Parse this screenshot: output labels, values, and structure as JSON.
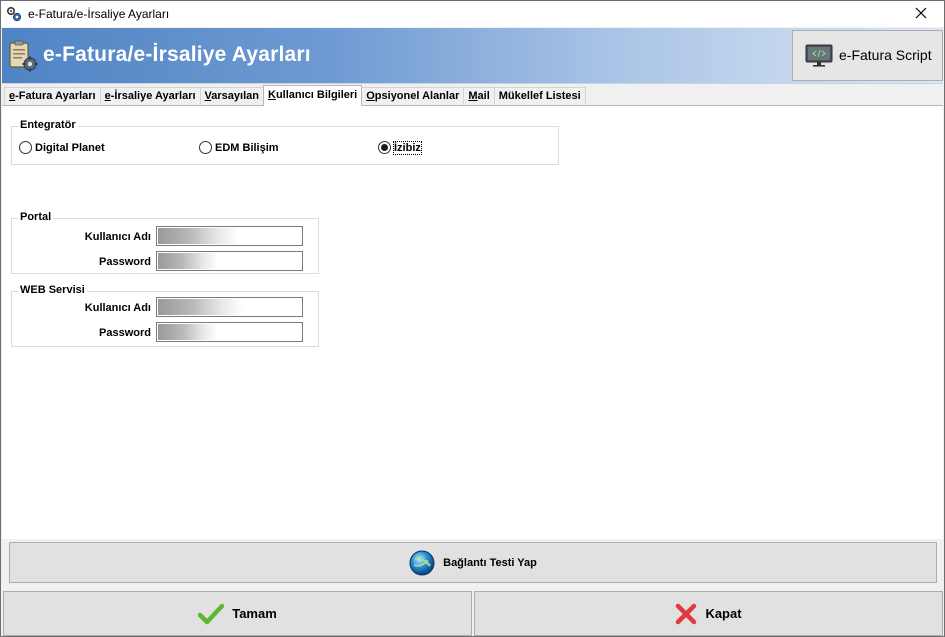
{
  "window": {
    "title": "e-Fatura/e-İrsaliye Ayarları",
    "app_icon": "gear-cogs-icon",
    "close_glyph": "✕"
  },
  "banner": {
    "title": "e-Fatura/e-İrsaliye Ayarları",
    "icon": "clipboard-gear-icon",
    "script_button_label": "e-Fatura Script",
    "script_button_icon": "code-monitor-icon"
  },
  "tabs": [
    {
      "label": "e-Fatura Ayarları",
      "ul": "e",
      "rest": "-Fatura Ayarları",
      "active": false
    },
    {
      "label": "e-İrsaliye Ayarları",
      "ul": "e",
      "rest": "-İrsaliye Ayarları",
      "active": false
    },
    {
      "label": "Varsayılan",
      "ul": "V",
      "rest": "arsayılan",
      "active": false
    },
    {
      "label": "Kullanıcı Bilgileri",
      "ul": "K",
      "rest": "ullanıcı Bilgileri",
      "active": true
    },
    {
      "label": "Opsiyonel Alanlar",
      "ul": "O",
      "rest": "psiyonel Alanlar",
      "active": false
    },
    {
      "label": "Mail",
      "ul": "M",
      "rest": "ail",
      "active": false
    },
    {
      "label": "Mükellef Listesi",
      "ul": "",
      "rest": "Mükellef Listesi",
      "active": false
    }
  ],
  "entegrator": {
    "legend": "Entegratör",
    "options": [
      {
        "label": "Digital Planet",
        "selected": false
      },
      {
        "label": "EDM Bilişim",
        "selected": false
      },
      {
        "label": "İzibiz",
        "selected": true
      }
    ]
  },
  "portal": {
    "legend": "Portal",
    "username_label": "Kullanıcı Adı",
    "password_label": "Password"
  },
  "web_servisi": {
    "legend": "WEB Servisi",
    "username_label": "Kullanıcı Adı",
    "password_label": "Password"
  },
  "buttons": {
    "test": {
      "label": "Bağlantı Testi Yap",
      "icon": "globe-icon"
    },
    "ok": {
      "label": "Tamam",
      "icon": "checkmark-icon",
      "color": "#5cb82e"
    },
    "close": {
      "label": "Kapat",
      "icon": "red-x-icon",
      "color": "#e0393e"
    }
  }
}
